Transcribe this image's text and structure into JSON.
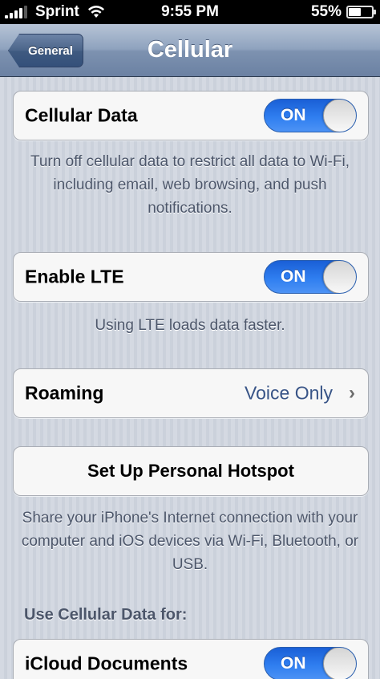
{
  "status_bar": {
    "carrier": "Sprint",
    "time": "9:55 PM",
    "battery_text": "55%",
    "battery_level": 0.55
  },
  "nav": {
    "back_label": "General",
    "title": "Cellular"
  },
  "cellular_data": {
    "label": "Cellular Data",
    "toggle": "ON",
    "footer": "Turn off cellular data to restrict all data to Wi-Fi, including email, web browsing, and push notifications."
  },
  "lte": {
    "label": "Enable LTE",
    "toggle": "ON",
    "footer": "Using LTE loads data faster."
  },
  "roaming": {
    "label": "Roaming",
    "value": "Voice Only",
    "chevron": "›"
  },
  "hotspot": {
    "label": "Set Up Personal Hotspot",
    "footer": "Share your iPhone's Internet connection with your computer and iOS devices via Wi-Fi, Bluetooth, or USB."
  },
  "use_cellular": {
    "header": "Use Cellular Data for:",
    "items": [
      {
        "label": "iCloud Documents",
        "toggle": "ON"
      }
    ]
  },
  "colors": {
    "toggle_on": "#2f7ef0",
    "value_text": "#385487",
    "footer_text": "#4c566a"
  }
}
